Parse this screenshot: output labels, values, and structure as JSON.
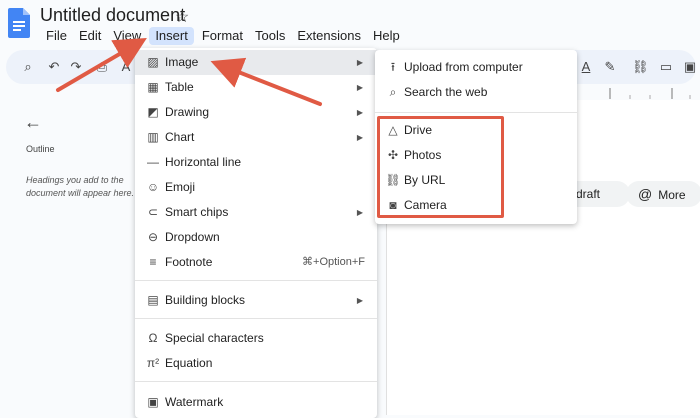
{
  "window": {
    "doc_title": "Untitled document"
  },
  "menubar": [
    "File",
    "Edit",
    "View",
    "Insert",
    "Format",
    "Tools",
    "Extensions",
    "Help"
  ],
  "left_panel": {
    "outline_label": "Outline",
    "hint": "Headings you add to the document will appear here."
  },
  "chips": {
    "draft": "l draft",
    "more": "More"
  },
  "insert_menu": [
    {
      "label": "Image",
      "icon": "image-icon",
      "submenu": true
    },
    {
      "label": "Table",
      "icon": "table-icon",
      "submenu": true
    },
    {
      "label": "Drawing",
      "icon": "drawing-icon",
      "submenu": true
    },
    {
      "label": "Chart",
      "icon": "chart-icon",
      "submenu": true
    },
    {
      "label": "Horizontal line",
      "icon": "horizontal-line-icon",
      "submenu": false
    },
    {
      "label": "Emoji",
      "icon": "emoji-icon",
      "submenu": false
    },
    {
      "label": "Smart chips",
      "icon": "smart-chips-icon",
      "submenu": true
    },
    {
      "label": "Dropdown",
      "icon": "dropdown-icon",
      "submenu": false
    },
    {
      "label": "Footnote",
      "icon": "footnote-icon",
      "submenu": false,
      "shortcut": "⌘+Option+F"
    },
    {
      "label": "Building blocks",
      "icon": "building-blocks-icon",
      "submenu": true
    },
    {
      "label": "Special characters",
      "icon": "omega-icon",
      "submenu": false
    },
    {
      "label": "Equation",
      "icon": "pi-icon",
      "submenu": false
    },
    {
      "label": "Watermark",
      "icon": "watermark-icon",
      "submenu": false
    }
  ],
  "image_submenu": [
    {
      "label": "Upload from computer",
      "icon": "upload-icon"
    },
    {
      "label": "Search the web",
      "icon": "search-icon"
    },
    {
      "label": "Drive",
      "icon": "drive-icon"
    },
    {
      "label": "Photos",
      "icon": "photos-icon"
    },
    {
      "label": "By URL",
      "icon": "link-icon"
    },
    {
      "label": "Camera",
      "icon": "camera-icon"
    }
  ],
  "colors": {
    "annotation": "#e05a44",
    "highlight": "#d3e3fd",
    "docs_blue": "#4285f4"
  }
}
